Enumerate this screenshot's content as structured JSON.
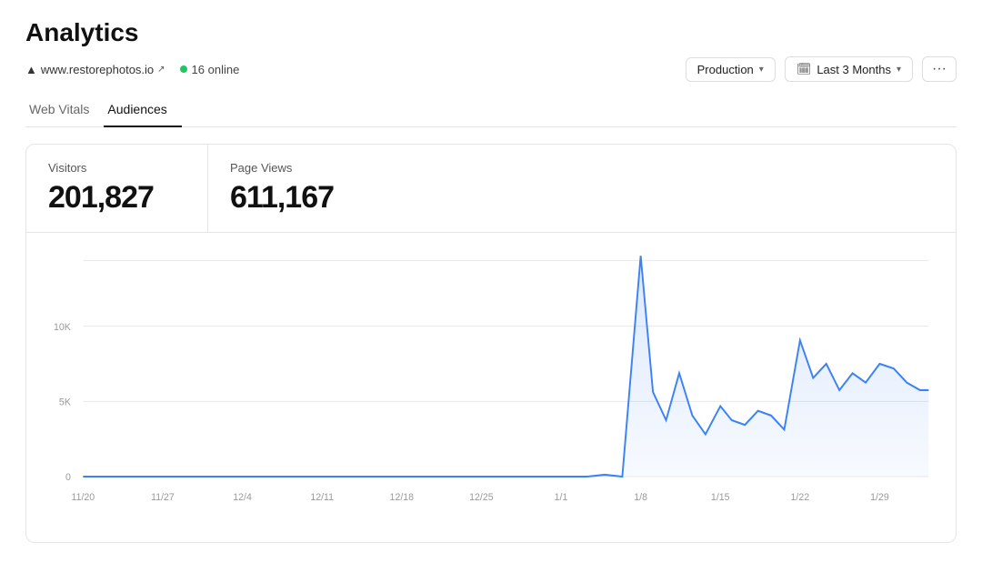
{
  "page": {
    "title": "Analytics"
  },
  "site": {
    "url": "www.restorephotos.io",
    "online_count": "16 online"
  },
  "controls": {
    "environment_label": "Production",
    "date_range_label": "Last 3 Months",
    "more_label": "···"
  },
  "tabs": [
    {
      "id": "web-vitals",
      "label": "Web Vitals",
      "active": false
    },
    {
      "id": "audiences",
      "label": "Audiences",
      "active": true
    }
  ],
  "metrics": [
    {
      "id": "visitors",
      "label": "Visitors",
      "value": "201,827"
    },
    {
      "id": "page-views",
      "label": "Page Views",
      "value": "611,167"
    }
  ],
  "chart": {
    "y_labels": [
      "0",
      "5K",
      "10K"
    ],
    "x_labels": [
      "11/20",
      "11/27",
      "12/4",
      "12/11",
      "12/18",
      "12/25",
      "1/1",
      "1/8",
      "1/15",
      "1/22",
      "1/29"
    ]
  }
}
